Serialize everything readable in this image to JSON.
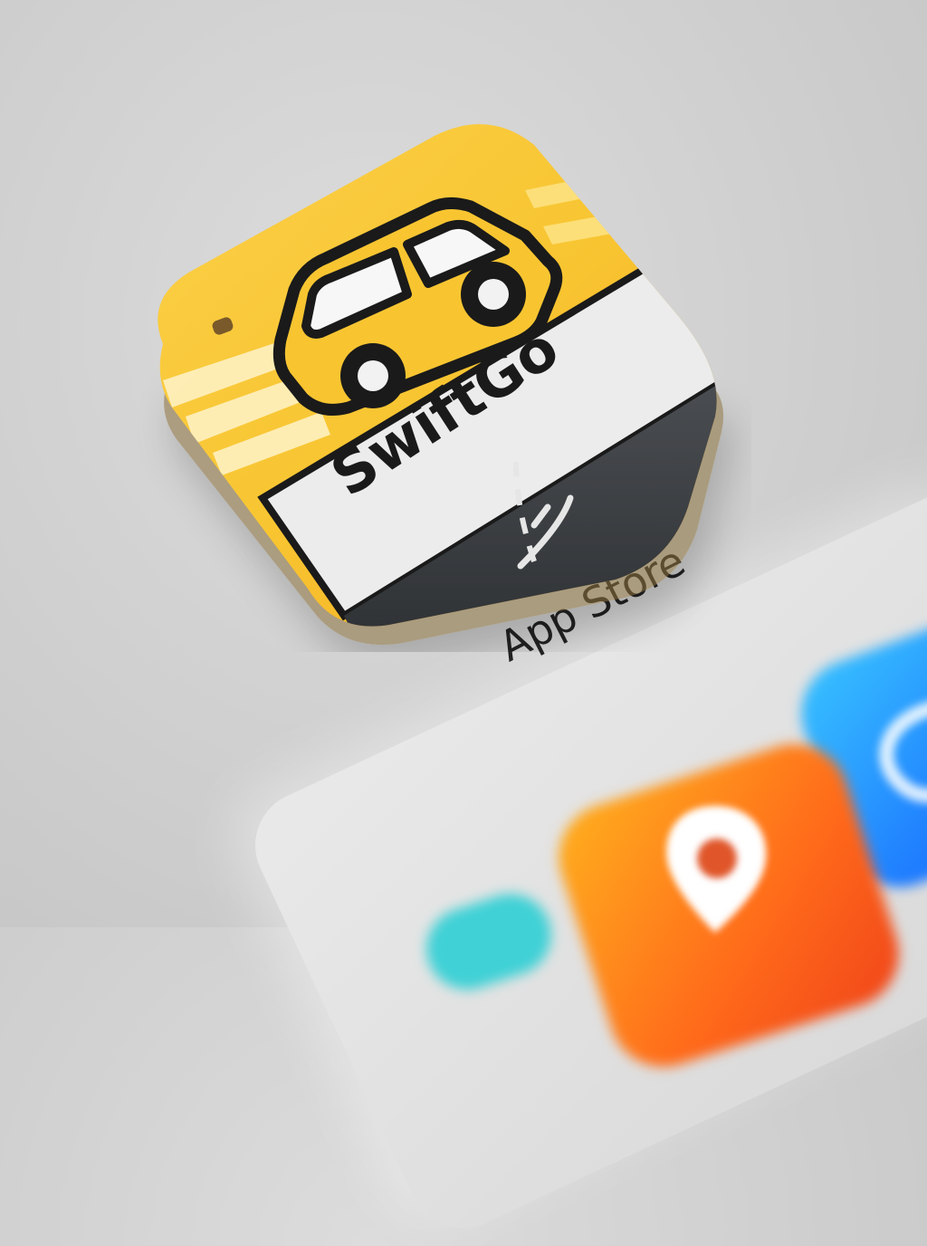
{
  "screen": {
    "app_store_label": "App Store"
  },
  "featured_app": {
    "name": "SwiftGo",
    "icon": "car-icon",
    "colors": {
      "yellow": "#f8c531",
      "orange": "#f5a623",
      "road": "#3f4246",
      "banner": "#ececec",
      "outline": "#1a1a1a"
    }
  },
  "background_apps": [
    {
      "icon": "map-pin-icon",
      "color": "#ff7a1e"
    },
    {
      "icon": "compass-swirl-icon",
      "color": "#2b95ff"
    },
    {
      "icon": "teal-app-icon",
      "color": "#3fd1d6"
    }
  ]
}
